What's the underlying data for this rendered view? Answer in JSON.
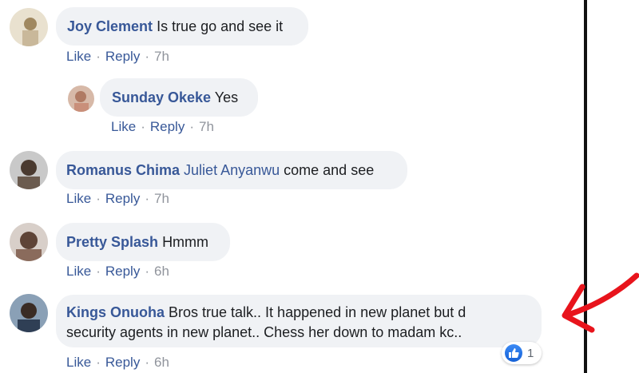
{
  "comments": [
    {
      "author": "Joy Clement",
      "text": "Is true go and see it",
      "like": "Like",
      "reply": "Reply",
      "time": "7h"
    },
    {
      "author": "Sunday Okeke",
      "text": "Yes",
      "like": "Like",
      "reply": "Reply",
      "time": "7h"
    },
    {
      "author": "Romanus Chima",
      "mention": "Juliet Anyanwu",
      "text": "come and see",
      "like": "Like",
      "reply": "Reply",
      "time": "7h"
    },
    {
      "author": "Pretty Splash",
      "text": "Hmmm",
      "like": "Like",
      "reply": "Reply",
      "time": "6h"
    },
    {
      "author": "Kings Onuoha",
      "text_line1": "Bros true talk.. It happened in new planet but d",
      "text_line2": "security agents in new planet.. Chess her down to madam kc..",
      "like": "Like",
      "reply": "Reply",
      "time": "6h",
      "reaction_count": "1"
    }
  ],
  "separator": "·",
  "colors": {
    "link": "#385898",
    "bubble": "#f0f2f5",
    "annotation": "#e8141c"
  },
  "icons": {
    "reaction": "thumbs-up-icon",
    "annotation": "red-arrow-annotation"
  }
}
